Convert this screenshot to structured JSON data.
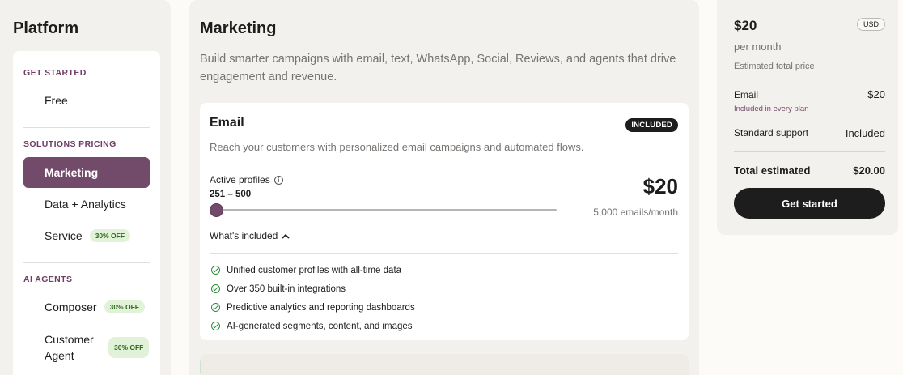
{
  "platform": {
    "title": "Platform",
    "sections": [
      {
        "heading": "GET STARTED",
        "items": [
          {
            "label": "Free"
          }
        ]
      },
      {
        "heading": "SOLUTIONS PRICING",
        "items": [
          {
            "label": "Marketing",
            "active": true
          },
          {
            "label": "Data + Analytics"
          },
          {
            "label": "Service",
            "badge": "30% OFF"
          }
        ]
      },
      {
        "heading": "AI AGENTS",
        "items": [
          {
            "label": "Composer",
            "badge": "30% OFF"
          },
          {
            "label": "Customer Agent",
            "badge": "30% OFF"
          }
        ]
      }
    ]
  },
  "marketing": {
    "title": "Marketing",
    "description": "Build smarter campaigns with email, text, WhatsApp, Social, Reviews, and agents that drive engagement and revenue.",
    "email_card": {
      "title": "Email",
      "badge": "INCLUDED",
      "description": "Reach your customers with personalized email campaigns and automated flows.",
      "profiles_label": "Active profiles",
      "profiles_range": "251 – 500",
      "slider_fraction": 0.0,
      "price": "$20",
      "emails_per_month": "5,000 emails/month",
      "whats_included": "What's included",
      "features": [
        "Unified customer profiles with all-time data",
        "Over 350 built-in integrations",
        "Predictive analytics and reporting dashboards",
        "AI-generated segments, content, and images"
      ]
    }
  },
  "summary": {
    "price": "$20",
    "currency": "USD",
    "period": "per month",
    "estimated_label": "Estimated total price",
    "lines": [
      {
        "label": "Email",
        "value": "$20",
        "sub": "Included in every plan"
      },
      {
        "label": "Standard support",
        "value": "Included"
      }
    ],
    "total_label": "Total estimated",
    "total_value": "$20.00",
    "cta": "Get started"
  },
  "colors": {
    "accent": "#724a6a",
    "panel_bg": "#f3f1ed",
    "badge_green_bg": "#e1f2d9",
    "dark": "#1d1d1d"
  },
  "icons": [
    "info-icon",
    "chevron-up-icon",
    "check-circle-icon"
  ]
}
